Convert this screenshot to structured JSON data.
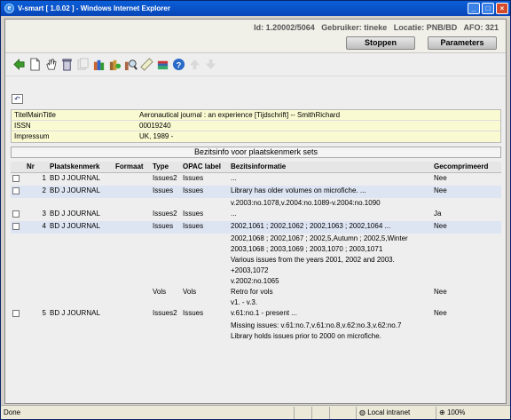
{
  "window": {
    "title": "V-smart [ 1.0.02 ] - Windows Internet Explorer"
  },
  "top": {
    "id_text": "Id: 1.20002/5064",
    "user_text": "Gebruiker: tineke",
    "location_text": "Locatie: PNB/BD",
    "afo_text": "AFO: 321",
    "stop_label": "Stoppen",
    "params_label": "Parameters"
  },
  "toolbar": {
    "icons": [
      "back-arrow-icon",
      "new-document-icon",
      "hand-select-icon",
      "trash-icon",
      "copy-icon",
      "books-icon",
      "books-add-icon",
      "search-books-icon",
      "ruler-icon",
      "books-stack-icon",
      "help-icon",
      "arrow-up-icon",
      "arrow-down-icon"
    ]
  },
  "info": [
    {
      "label": "TitelMainTitle",
      "value": "Aeronautical journal : an experience [Tijdschrift] -- SmithRichard"
    },
    {
      "label": "ISSN",
      "value": "00019240"
    },
    {
      "label": "Impressum",
      "value": "UK, 1989 -"
    }
  ],
  "section_title": "Bezitsinfo voor plaatskenmerk sets",
  "columns": [
    "Nr",
    "Plaatskenmerk",
    "Formaat",
    "Type",
    "OPAC label",
    "Bezitsinformatie",
    "Gecomprimeerd"
  ],
  "rows": [
    {
      "nr": "1",
      "plaats": "BD J JOURNAL",
      "formaat": "",
      "type": "Issues2",
      "opac": "Issues",
      "bezit": "...",
      "comp": "Nee",
      "alt": false,
      "cb": true
    },
    {
      "nr": "2",
      "plaats": "BD J JOURNAL",
      "formaat": "",
      "type": "Issues",
      "opac": "Issues",
      "bezit": "Library has older volumes on microfiche. ...",
      "comp": "Nee",
      "alt": true,
      "cb": true
    },
    {
      "nr": "",
      "plaats": "",
      "formaat": "",
      "type": "",
      "opac": "",
      "bezit": "v.2003:no.1078,v.2004:no.1089-v.2004:no.1090",
      "comp": "",
      "alt": false,
      "cb": false
    },
    {
      "nr": "3",
      "plaats": "BD J JOURNAL",
      "formaat": "",
      "type": "Issues2",
      "opac": "Issues",
      "bezit": "...",
      "comp": "Ja",
      "alt": false,
      "cb": true
    },
    {
      "nr": "4",
      "plaats": "BD J JOURNAL",
      "formaat": "",
      "type": "Issues",
      "opac": "Issues",
      "bezit": "2002,1061 ; 2002,1062 ; 2002,1063 ; 2002,1064 ...",
      "comp": "Nee",
      "alt": true,
      "cb": true
    },
    {
      "nr": "",
      "plaats": "",
      "formaat": "",
      "type": "",
      "opac": "",
      "bezit": "2002,1068 ; 2002,1067 ; 2002,5,Autumn ; 2002,5,Winter",
      "comp": "",
      "alt": false,
      "cb": false
    },
    {
      "nr": "",
      "plaats": "",
      "formaat": "",
      "type": "",
      "opac": "",
      "bezit": "2003,1068 ; 2003,1069 ; 2003,1070 ; 2003,1071",
      "comp": "",
      "alt": false,
      "cb": false
    },
    {
      "nr": "",
      "plaats": "",
      "formaat": "",
      "type": "",
      "opac": "",
      "bezit": "Various issues from the years 2001, 2002 and 2003.",
      "comp": "",
      "alt": false,
      "cb": false
    },
    {
      "nr": "",
      "plaats": "",
      "formaat": "",
      "type": "",
      "opac": "",
      "bezit": "+2003,1072",
      "comp": "",
      "alt": false,
      "cb": false
    },
    {
      "nr": "",
      "plaats": "",
      "formaat": "",
      "type": "",
      "opac": "",
      "bezit": "v.2002:no.1065",
      "comp": "",
      "alt": false,
      "cb": false
    },
    {
      "nr": "",
      "plaats": "",
      "formaat": "",
      "type": "Vols",
      "opac": "Vols",
      "bezit": "Retro for vols",
      "comp": "Nee",
      "alt": false,
      "cb": false
    },
    {
      "nr": "",
      "plaats": "",
      "formaat": "",
      "type": "",
      "opac": "",
      "bezit": "v1. - v.3.",
      "comp": "",
      "alt": false,
      "cb": false
    },
    {
      "nr": "5",
      "plaats": "BD J JOURNAL",
      "formaat": "",
      "type": "Issues2",
      "opac": "Issues",
      "bezit": "v.61:no.1 - present ...",
      "comp": "Nee",
      "alt": false,
      "cb": true
    },
    {
      "nr": "",
      "plaats": "",
      "formaat": "",
      "type": "",
      "opac": "",
      "bezit": "Missing issues: v.61:no.7,v.61:no.8,v.62:no.3,v.62:no.7",
      "comp": "",
      "alt": false,
      "cb": false
    },
    {
      "nr": "",
      "plaats": "",
      "formaat": "",
      "type": "",
      "opac": "",
      "bezit": "Library holds issues prior to 2000 on microfiche.",
      "comp": "",
      "alt": false,
      "cb": false
    }
  ],
  "status": {
    "left": "Done",
    "zone": "Local intranet",
    "zoom": "100%"
  }
}
